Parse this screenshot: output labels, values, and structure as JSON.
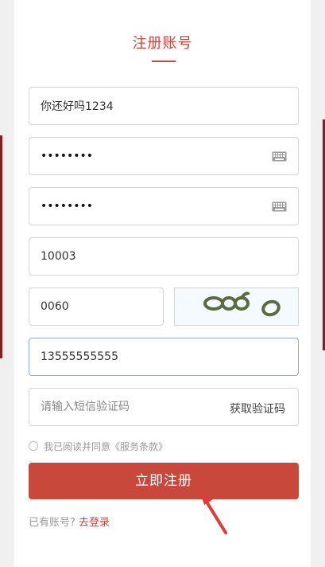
{
  "page_title": "注册账号",
  "form": {
    "username": {
      "value": "你还好吗1234"
    },
    "password": {
      "masked": "••••••••",
      "icon": "keyboard-icon"
    },
    "confirm_password": {
      "masked": "••••••••",
      "icon": "keyboard-icon"
    },
    "third_field": {
      "value": "10003"
    },
    "captcha": {
      "value": "0060",
      "image_text": "OO6 O"
    },
    "phone": {
      "value": "13555555555"
    },
    "sms_code": {
      "placeholder": "请输入短信验证码",
      "get_code_label": "获取验证码"
    }
  },
  "agreement": {
    "text": "我已阅读并同意《服务条款》"
  },
  "submit_label": "立即注册",
  "login": {
    "prompt": "已有账号?",
    "link": "去登录"
  },
  "colors": {
    "accent": "#c8483c",
    "focus_border": "#8fa8d8",
    "captcha_ink": "#5a6b3f"
  }
}
